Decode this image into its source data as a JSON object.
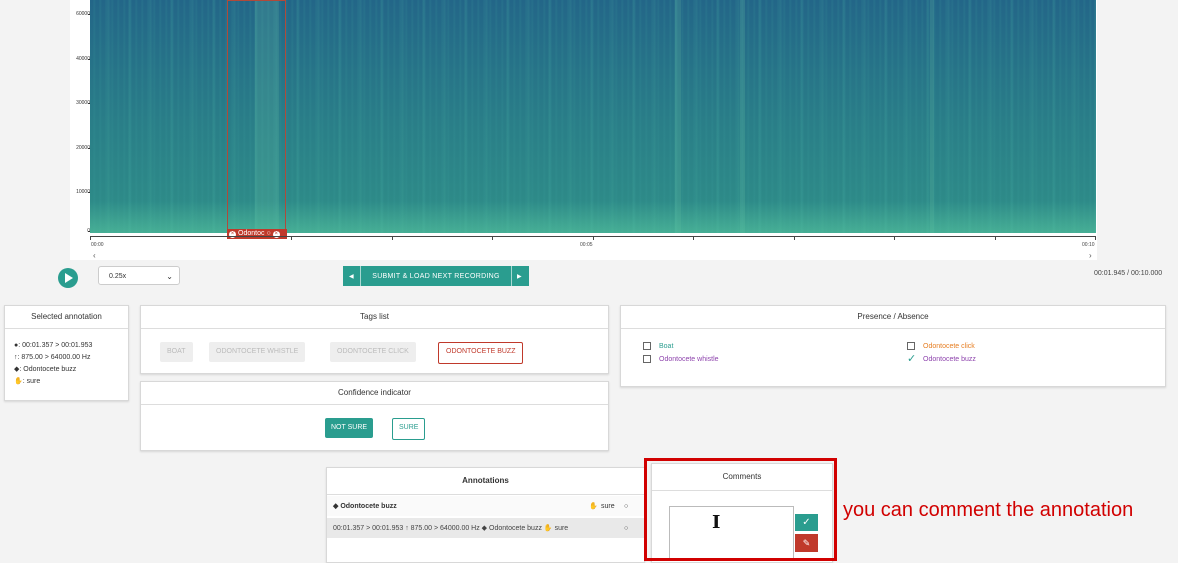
{
  "spectrogram": {
    "y_ticks": [
      "60000",
      "40000",
      "30000",
      "20000",
      "10000",
      "0"
    ],
    "x_ticks": [
      "00:00",
      "00:05",
      "00:10"
    ],
    "annotation_label": "Odontoc"
  },
  "player": {
    "speed": "0.25x",
    "submit_label": "SUBMIT & LOAD NEXT RECORDING",
    "time_readout": "00:01.945 / 00:10.000"
  },
  "selected_annotation": {
    "title": "Selected annotation",
    "time": ": 00:01.357 > 00:01.953",
    "freq": ": 875.00 > 64000.00 Hz",
    "tag": ": Odontocete buzz",
    "confidence": ": sure"
  },
  "tags": {
    "title": "Tags list",
    "items": [
      "BOAT",
      "ODONTOCETE WHISTLE",
      "ODONTOCETE CLICK",
      "ODONTOCETE BUZZ"
    ]
  },
  "confidence": {
    "title": "Confidence indicator",
    "not_sure": "NOT SURE",
    "sure": "SURE"
  },
  "presence": {
    "title": "Presence / Absence",
    "items": [
      "Boat",
      "Odontocete whistle",
      "Odontocete click",
      "Odontocete buzz"
    ],
    "colors": {
      "boat": "#2a9d8f",
      "whistle": "#8e44ad",
      "click": "#e67e22",
      "buzz": "#8e44ad"
    }
  },
  "annotations": {
    "title": "Annotations",
    "group_tag": "Odontocete buzz",
    "group_conf": "sure",
    "row_detail": "00:01.357 > 00:01.953 ↑ 875.00 > 64000.00 Hz",
    "row_tag": "Odontocete buzz",
    "row_conf": "sure"
  },
  "comments": {
    "title": "Comments",
    "cursor": "I"
  },
  "caption": "you can comment the annotation"
}
